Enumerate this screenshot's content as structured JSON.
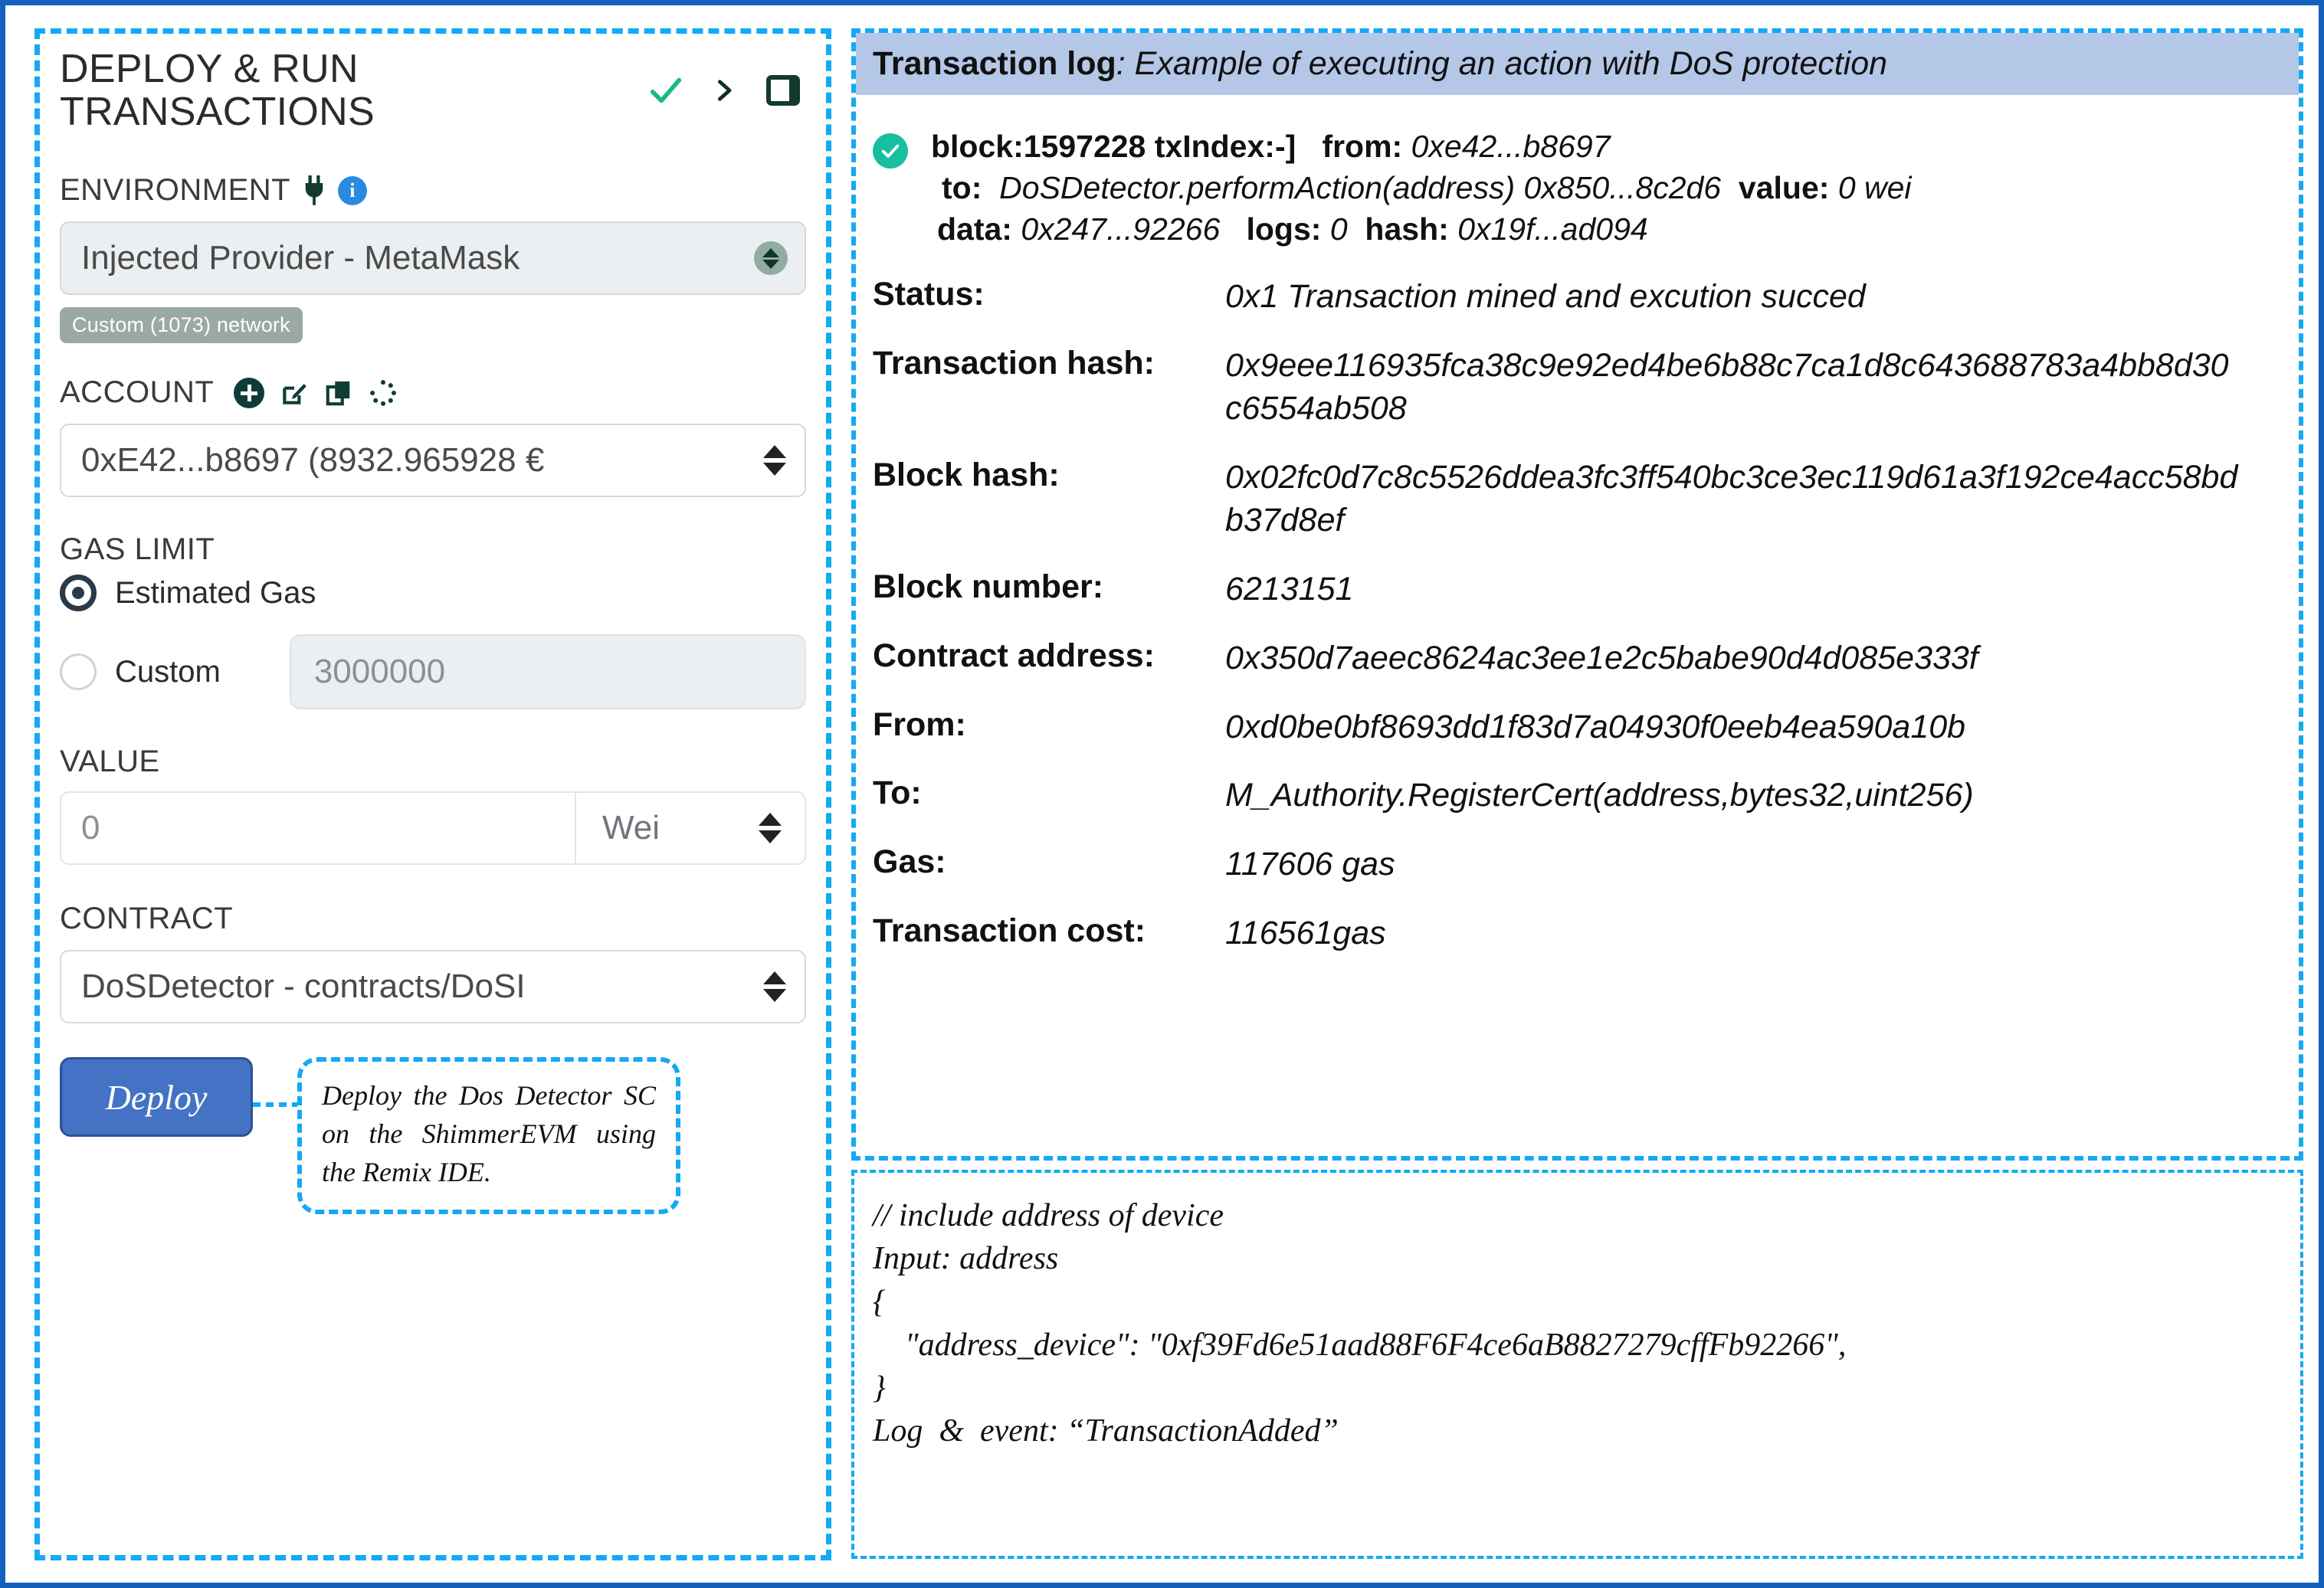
{
  "left_panel": {
    "title": "DEPLOY & RUN\nTRANSACTIONS",
    "icons": {
      "check": "check-icon",
      "chevron": "chevron-right-icon",
      "layout": "layout-panel-icon"
    },
    "environment": {
      "label": "ENVIRONMENT",
      "plug_icon": "plug-icon",
      "info_icon": "info-icon",
      "selected": "Injected Provider - MetaMask",
      "network_badge": "Custom (1073) network"
    },
    "account": {
      "label": "ACCOUNT",
      "icons": [
        "plus-circle-icon",
        "edit-icon",
        "copy-icon",
        "spinner-icon"
      ],
      "selected": "0xE42...b8697 (8932.965928 €"
    },
    "gas_limit": {
      "label": "GAS LIMIT",
      "estimated_label": "Estimated Gas",
      "estimated_selected": true,
      "custom_label": "Custom",
      "custom_value": "3000000"
    },
    "value": {
      "label": "VALUE",
      "amount": "0",
      "unit": "Wei"
    },
    "contract": {
      "label": "CONTRACT",
      "selected": "DoSDetector - contracts/DoSI"
    },
    "deploy": {
      "button_label": "Deploy",
      "callout": "Deploy the Dos Detector SC on the ShimmerEVM using the Remix IDE."
    }
  },
  "right_panel": {
    "header": {
      "title": "Transaction log",
      "subtitle": ": Example of executing an action with DoS protection"
    },
    "summary": {
      "line1": {
        "block": "block:1597228 txIndex:-]",
        "from_key": "from:",
        "from_val": "0xe42...b8697"
      },
      "line2": {
        "to_key": "to:",
        "to_val": "DoSDetector.performAction(address) 0x850...8c2d6",
        "value_key": "value:",
        "value_val": "0 wei"
      },
      "line3": {
        "data_key": "data:",
        "data_val": "0x247...92266",
        "logs_key": "logs:",
        "logs_val": "0",
        "hash_key": "hash:",
        "hash_val": "0x19f...ad094"
      }
    },
    "rows": [
      {
        "key": "Status:",
        "value": "0x1 Transaction mined and excution succed"
      },
      {
        "key": "Transaction hash:",
        "value": "0x9eee116935fca38c9e92ed4be6b88c7ca1d8c643688783a4bb8d30c6554ab508"
      },
      {
        "key": "Block hash:",
        "value": "0x02fc0d7c8c5526ddea3fc3ff540bc3ce3ec119d61a3f192ce4acc58bdb37d8ef"
      },
      {
        "key": "Block number:",
        "value": "6213151"
      },
      {
        "key": "Contract address:",
        "value": "0x350d7aeec8624ac3ee1e2c5babe90d4d085e333f"
      },
      {
        "key": "From:",
        "value": "0xd0be0bf8693dd1f83d7a04930f0eeb4ea590a10b"
      },
      {
        "key": "To:",
        "value": "M_Authority.RegisterCert(address,bytes32,uint256)"
      },
      {
        "key": "Gas:",
        "value": "117606 gas"
      },
      {
        "key": "Transaction cost:",
        "value": "116561gas"
      }
    ],
    "code_block": "// include address of device\nInput: address\n{\n    \"address_device\": \"0xf39Fd6e51aad88F6F4ce6aB8827279cffFb92266\",\n}\nLog  &  event: “TransactionAdded”"
  },
  "colors": {
    "frame_blue": "#1560BD",
    "dashed_blue": "#14A9F5",
    "header_bar": "#B4C7E7",
    "deploy_button": "#4472C4",
    "success_green": "#17BFA0",
    "dark_green": "#0f3d35",
    "info_blue": "#2a8ae0",
    "badge_gray": "#9aa9a4"
  }
}
